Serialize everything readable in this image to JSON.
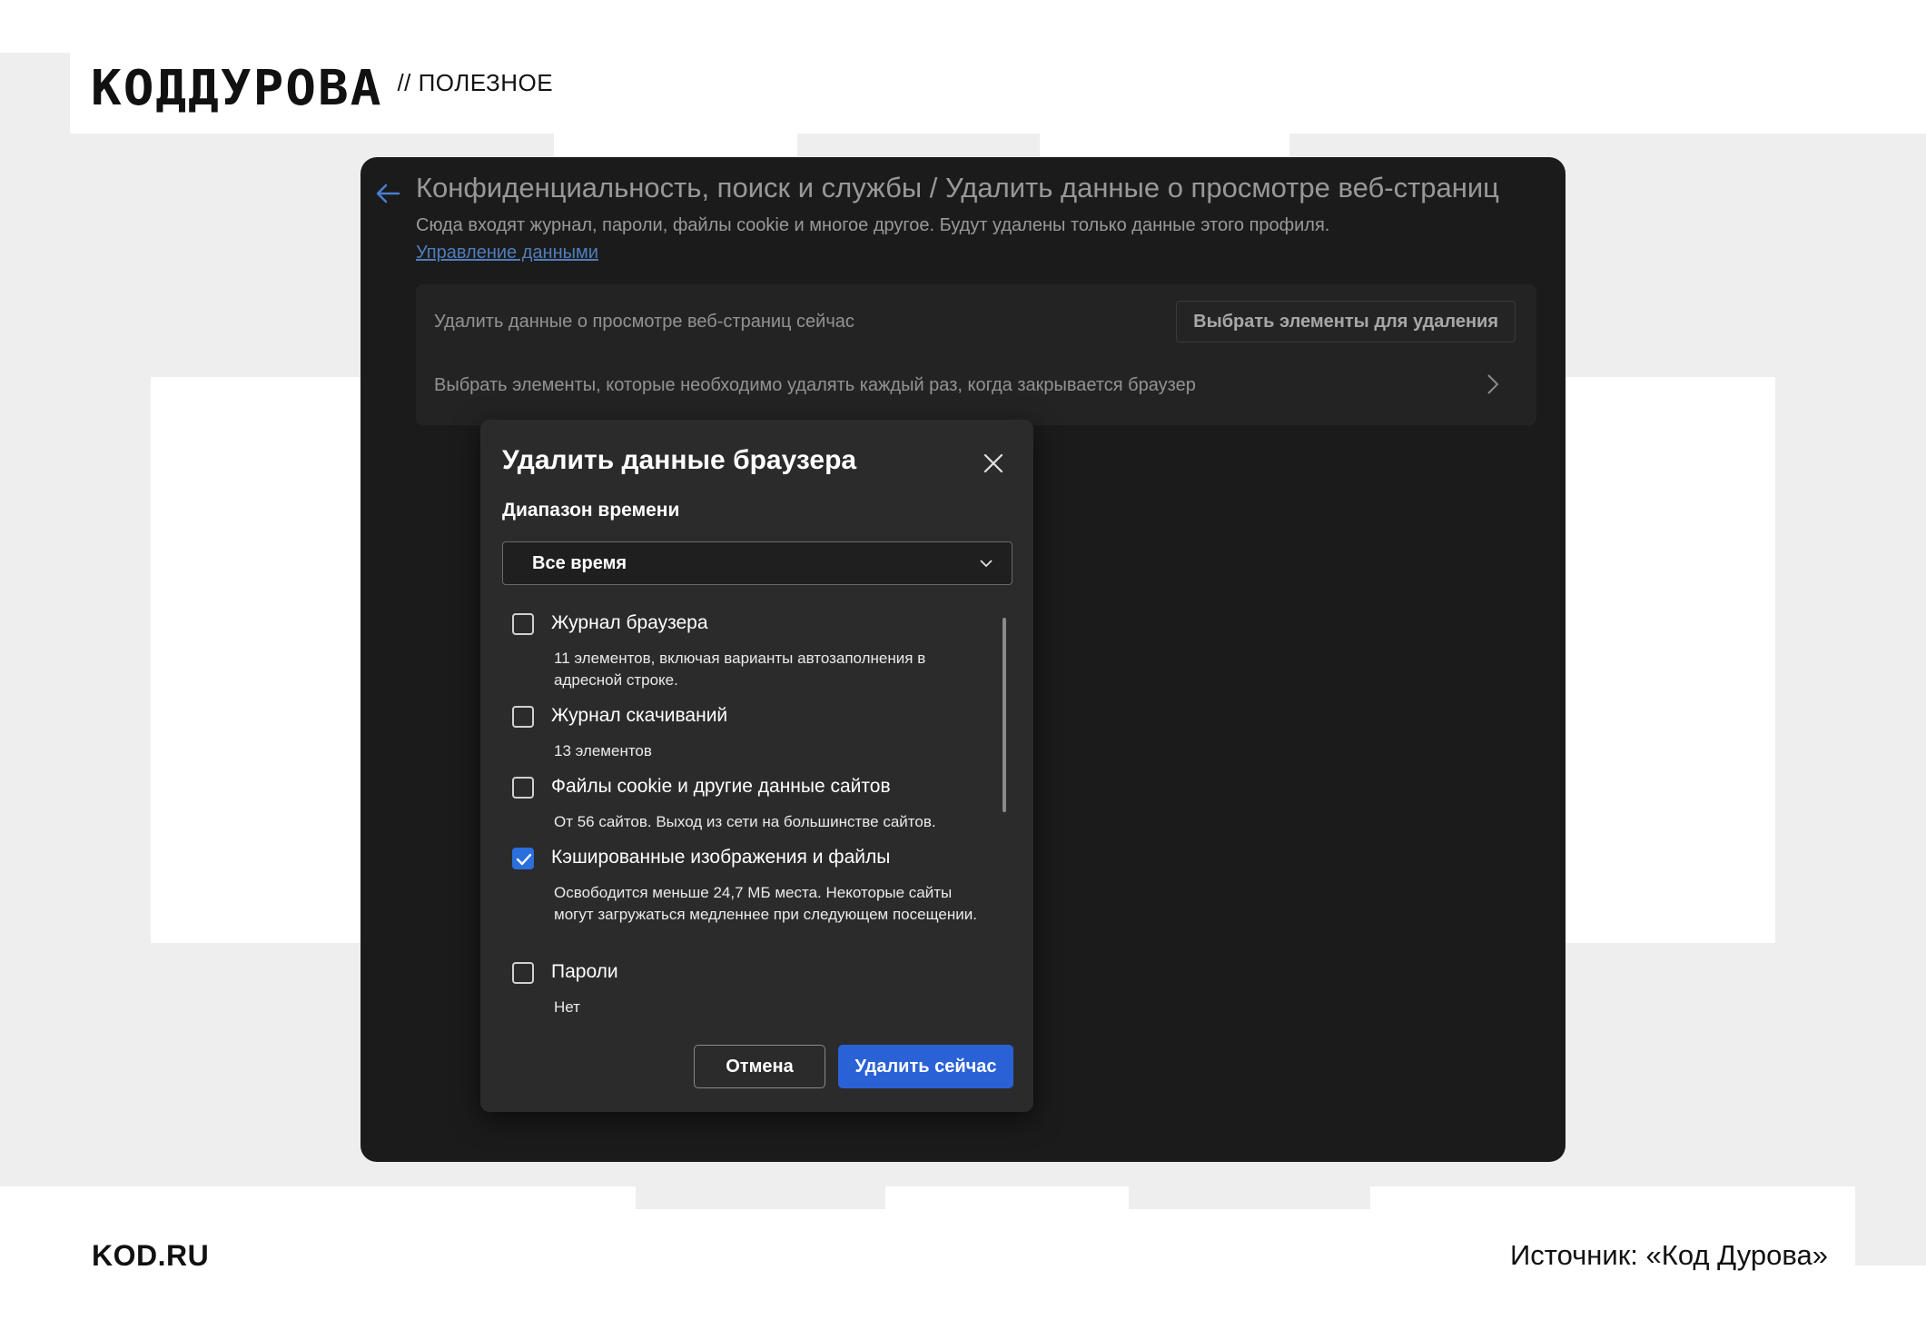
{
  "brand": {
    "logo": "КОДДУРОВА",
    "section": "// ПОЛЕЗНОЕ"
  },
  "footer": {
    "site": "KOD.RU",
    "source": "Источник: «Код Дурова»"
  },
  "settings": {
    "title": "Конфиденциальность, поиск и службы / Удалить данные о просмотре веб-страниц",
    "description": "Сюда входят журнал, пароли, файлы cookie и многое другое. Будут удалены только данные этого профиля.",
    "manage_link": "Управление данными",
    "clear_now_label": "Удалить данные о просмотре веб-страниц сейчас",
    "choose_button": "Выбрать элементы для удаления",
    "on_close_label": "Выбрать элементы, которые необходимо удалять каждый раз, когда закрывается браузер"
  },
  "dialog": {
    "title": "Удалить данные браузера",
    "time_range_label": "Диапазон времени",
    "time_range_value": "Все время",
    "options": [
      {
        "title": "Журнал браузера",
        "desc": "11 элементов, включая варианты автозаполнения в адресной строке.",
        "checked": false
      },
      {
        "title": "Журнал скачиваний",
        "desc": "13 элементов",
        "checked": false
      },
      {
        "title": "Файлы cookie и другие данные сайтов",
        "desc": "От 56 сайтов. Выход из сети на большинстве сайтов.",
        "checked": false
      },
      {
        "title": "Кэшированные изображения и файлы",
        "desc": "Освободится меньше 24,7 МБ места. Некоторые сайты могут загружаться медленнее при следующем посещении.",
        "checked": true
      },
      {
        "title": "Пароли",
        "desc": "Нет",
        "checked": false
      }
    ],
    "cancel_button": "Отмена",
    "delete_button": "Удалить сейчас"
  },
  "colors": {
    "accent": "#2a62d6",
    "window_bg": "#1b1b1b",
    "dialog_bg": "#2b2b2b"
  }
}
